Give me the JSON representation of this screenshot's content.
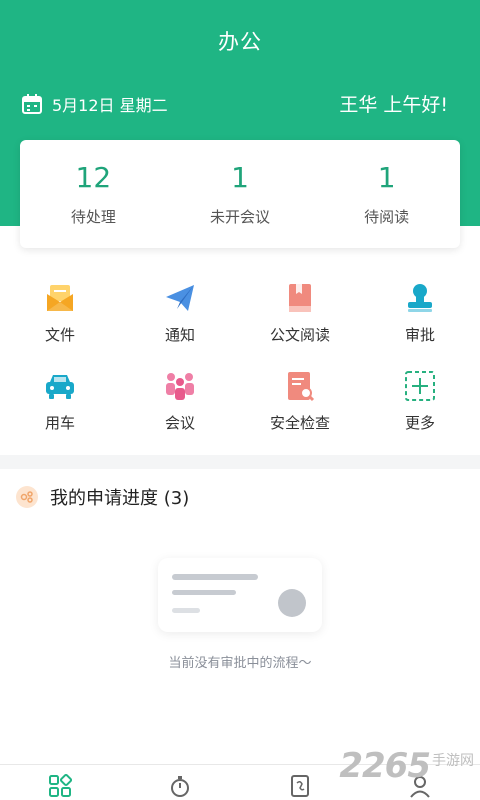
{
  "header": {
    "title": "办公",
    "date": "5月12日 星期二",
    "greeting": "王华 上午好!"
  },
  "stats": [
    {
      "count": "12",
      "label": "待处理"
    },
    {
      "count": "1",
      "label": "未开会议"
    },
    {
      "count": "1",
      "label": "待阅读"
    }
  ],
  "menu": [
    {
      "label": "文件",
      "icon": "file-envelope-icon"
    },
    {
      "label": "通知",
      "icon": "paper-plane-icon"
    },
    {
      "label": "公文阅读",
      "icon": "book-icon"
    },
    {
      "label": "审批",
      "icon": "stamp-icon"
    },
    {
      "label": "用车",
      "icon": "car-icon"
    },
    {
      "label": "会议",
      "icon": "meeting-people-icon"
    },
    {
      "label": "安全检查",
      "icon": "inspection-doc-icon"
    },
    {
      "label": "更多",
      "icon": "more-plus-icon"
    }
  ],
  "applications": {
    "title": "我的申请进度 (3)",
    "empty_text": "当前没有审批中的流程～"
  },
  "tabbar": [
    {
      "icon": "workbench-icon"
    },
    {
      "icon": "stopwatch-icon"
    },
    {
      "icon": "contacts-book-icon"
    },
    {
      "icon": "person-icon"
    }
  ],
  "watermark": {
    "number": "2265",
    "text": "手游网"
  },
  "colors": {
    "brand": "#1fb584",
    "number": "#1fa47a"
  }
}
